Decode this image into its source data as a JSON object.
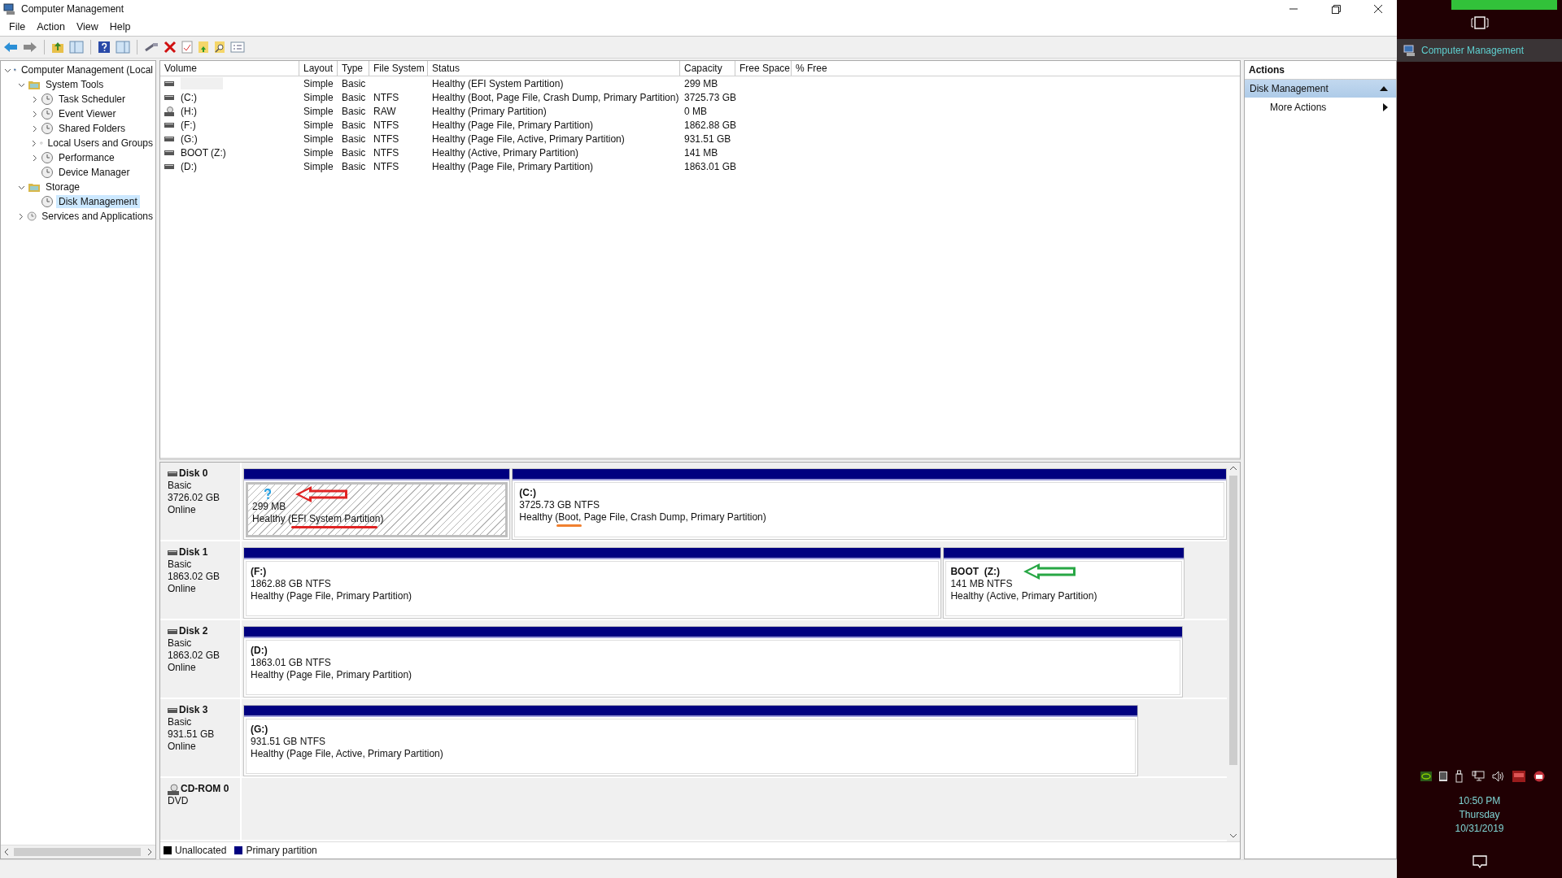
{
  "window": {
    "title": "Computer Management"
  },
  "menu": [
    "File",
    "Action",
    "View",
    "Help"
  ],
  "tree": [
    {
      "label": "Computer Management (Local",
      "expanded": true,
      "selected": false,
      "children": [
        {
          "label": "System Tools",
          "expanded": true,
          "selected": false,
          "children": [
            {
              "label": "Task Scheduler",
              "expanded": false,
              "selected": false
            },
            {
              "label": "Event Viewer",
              "expanded": false,
              "selected": false
            },
            {
              "label": "Shared Folders",
              "expanded": false,
              "selected": false
            },
            {
              "label": "Local Users and Groups",
              "expanded": false,
              "selected": false
            },
            {
              "label": "Performance",
              "expanded": false,
              "selected": false
            },
            {
              "label": "Device Manager",
              "selected": false
            }
          ]
        },
        {
          "label": "Storage",
          "expanded": true,
          "selected": false,
          "children": [
            {
              "label": "Disk Management",
              "selected": true
            }
          ]
        },
        {
          "label": "Services and Applications",
          "expanded": false,
          "selected": false
        }
      ]
    }
  ],
  "volume_table": {
    "columns": [
      "Volume",
      "Layout",
      "Type",
      "File System",
      "Status",
      "Capacity",
      "Free Space",
      "% Free"
    ],
    "rows": [
      {
        "kind": "disk",
        "cells": [
          "",
          "Simple",
          "Basic",
          "",
          "Healthy (EFI System Partition)",
          "299 MB"
        ]
      },
      {
        "kind": "disk",
        "cells": [
          "(C:)",
          "Simple",
          "Basic",
          "NTFS",
          "Healthy (Boot, Page File, Crash Dump, Primary Partition)",
          "3725.73 GB"
        ]
      },
      {
        "kind": "optical",
        "cells": [
          "(H:)",
          "Simple",
          "Basic",
          "RAW",
          "Healthy (Primary Partition)",
          "0 MB"
        ]
      },
      {
        "kind": "disk",
        "cells": [
          "(F:)",
          "Simple",
          "Basic",
          "NTFS",
          "Healthy (Page File, Primary Partition)",
          "1862.88 GB"
        ]
      },
      {
        "kind": "disk",
        "cells": [
          "(G:)",
          "Simple",
          "Basic",
          "NTFS",
          "Healthy (Page File, Active, Primary Partition)",
          "931.51 GB"
        ]
      },
      {
        "kind": "disk",
        "cells": [
          "BOOT (Z:)",
          "Simple",
          "Basic",
          "NTFS",
          "Healthy (Active, Primary Partition)",
          "141 MB"
        ]
      },
      {
        "kind": "disk",
        "cells": [
          "(D:)",
          "Simple",
          "Basic",
          "NTFS",
          "Healthy (Page File, Primary Partition)",
          "1863.01 GB"
        ]
      }
    ]
  },
  "disks": [
    {
      "kind": "disk",
      "name": "Disk 0",
      "type": "Basic",
      "size": "3726.02 GB",
      "status": "Online",
      "partitions": [
        {
          "size": "299 MB",
          "status": "Healthy (EFI System Partition)",
          "selected": true,
          "arrow": {
            "color": "#e02424"
          },
          "underline": {
            "color": "#e02424"
          }
        },
        {
          "label": "(C:)",
          "size": "3725.73 GB NTFS",
          "status": "Healthy (Boot, Page File, Crash Dump, Primary Partition)",
          "selected": false,
          "underline": {
            "color": "#f08030"
          }
        }
      ]
    },
    {
      "kind": "disk",
      "name": "Disk 1",
      "type": "Basic",
      "size": "1863.02 GB",
      "status": "Online",
      "partitions": [
        {
          "label": "(F:)",
          "size": "1862.88 GB NTFS",
          "status": "Healthy (Page File, Primary Partition)",
          "selected": false
        },
        {
          "label": "BOOT  (Z:)",
          "size": "141 MB NTFS",
          "status": "Healthy (Active, Primary Partition)",
          "selected": false,
          "arrow": {
            "color": "#28a745"
          }
        }
      ]
    },
    {
      "kind": "disk",
      "name": "Disk 2",
      "type": "Basic",
      "size": "1863.02 GB",
      "status": "Online",
      "partitions": [
        {
          "label": "(D:)",
          "size": "1863.01 GB NTFS",
          "status": "Healthy (Page File, Primary Partition)",
          "selected": false
        }
      ]
    },
    {
      "kind": "disk",
      "name": "Disk 3",
      "type": "Basic",
      "size": "931.51 GB",
      "status": "Online",
      "partitions": [
        {
          "label": "(G:)",
          "size": "931.51 GB NTFS",
          "status": "Healthy (Page File, Active, Primary Partition)",
          "selected": false
        }
      ]
    },
    {
      "kind": "cdrom",
      "name": "CD-ROM 0",
      "type": "DVD"
    }
  ],
  "legend": [
    {
      "label": "Unallocated",
      "color": "#000000"
    },
    {
      "label": "Primary partition",
      "color": "#000080"
    }
  ],
  "actions": {
    "header": "Actions",
    "items": [
      {
        "kind": "section",
        "label": "Disk Management"
      },
      {
        "kind": "item",
        "label": "More Actions"
      }
    ]
  },
  "taskbar": {
    "app": "Computer Management",
    "time": "10:50 PM",
    "day": "Thursday",
    "date": "10/31/2019"
  }
}
